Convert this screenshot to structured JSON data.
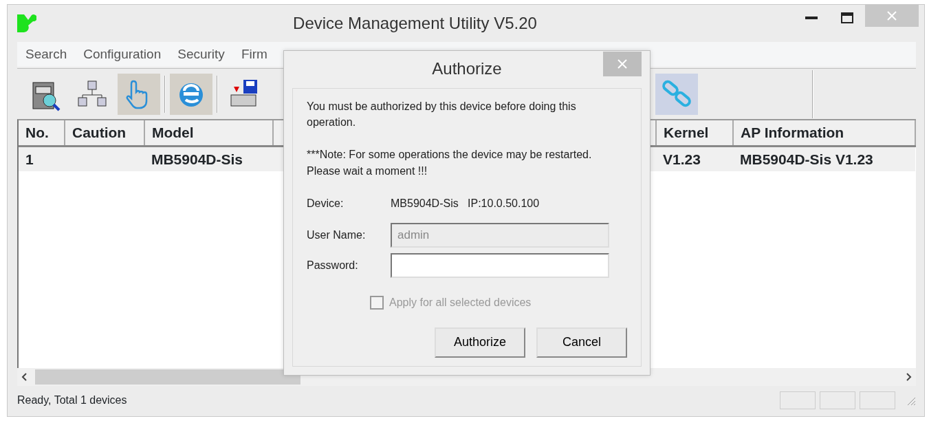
{
  "window": {
    "title": "Device Management Utility V5.20"
  },
  "menu": [
    "Search",
    "Configuration",
    "Security",
    "Firm"
  ],
  "toolbar": [
    {
      "kind": "search-drawer",
      "pressed": false
    },
    {
      "kind": "network",
      "pressed": false
    },
    {
      "kind": "hand",
      "pressed": true
    },
    {
      "kind": "browser",
      "pressed": true
    },
    {
      "kind": "floppy",
      "pressed": false
    },
    {
      "kind": "link",
      "pressed": true
    }
  ],
  "table": {
    "columns": [
      "No.",
      "Caution",
      "Model",
      "Kernel",
      "AP Information"
    ],
    "rows": [
      {
        "cells": [
          "1",
          "",
          "MB5904D-Sis",
          "V1.23",
          "MB5904D-Sis V1.23"
        ],
        "selected": false
      }
    ]
  },
  "status_bar": {
    "text": "Ready, Total 1 devices"
  },
  "dialog": {
    "title": "Authorize",
    "message": "You must be authorized by this device before doing this operation.",
    "note": "***Note: For some operations the device may be restarted. Please wait a moment !!!",
    "device_label": "Device:",
    "device_value": "MB5904D-Sis   IP:10.0.50.100",
    "username_label": "User Name:",
    "username": "admin",
    "username_disabled": true,
    "password_label": "Password:",
    "apply_all": {
      "label": "Apply for all selected devices",
      "checked": false,
      "disabled": true
    },
    "buttons": [
      "Authorize",
      "Cancel"
    ]
  }
}
